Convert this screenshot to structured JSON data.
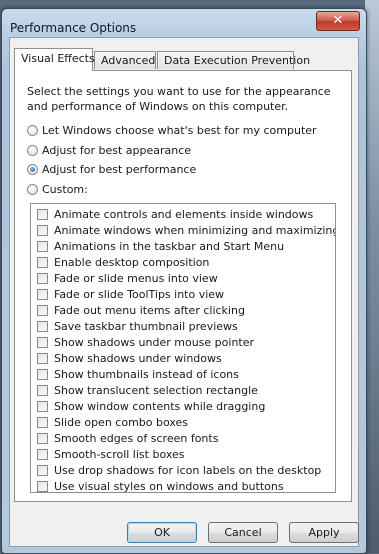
{
  "window": {
    "title": "Performance Options",
    "close_glyph": "✕"
  },
  "tabs": [
    {
      "label": "Visual Effects",
      "active": true
    },
    {
      "label": "Advanced",
      "active": false
    },
    {
      "label": "Data Execution Prevention",
      "active": false
    }
  ],
  "visual_effects": {
    "description": "Select the settings you want to use for the appearance and performance of Windows on this computer.",
    "options": [
      {
        "label": "Let Windows choose what's best for my computer",
        "checked": false
      },
      {
        "label": "Adjust for best appearance",
        "checked": false
      },
      {
        "label": "Adjust for best performance",
        "checked": true
      },
      {
        "label": "Custom:",
        "checked": false
      }
    ],
    "effects": [
      {
        "label": "Animate controls and elements inside windows",
        "checked": false
      },
      {
        "label": "Animate windows when minimizing and maximizing",
        "checked": false
      },
      {
        "label": "Animations in the taskbar and Start Menu",
        "checked": false
      },
      {
        "label": "Enable desktop composition",
        "checked": false
      },
      {
        "label": "Fade or slide menus into view",
        "checked": false
      },
      {
        "label": "Fade or slide ToolTips into view",
        "checked": false
      },
      {
        "label": "Fade out menu items after clicking",
        "checked": false
      },
      {
        "label": "Save taskbar thumbnail previews",
        "checked": false
      },
      {
        "label": "Show shadows under mouse pointer",
        "checked": false
      },
      {
        "label": "Show shadows under windows",
        "checked": false
      },
      {
        "label": "Show thumbnails instead of icons",
        "checked": false
      },
      {
        "label": "Show translucent selection rectangle",
        "checked": false
      },
      {
        "label": "Show window contents while dragging",
        "checked": false
      },
      {
        "label": "Slide open combo boxes",
        "checked": false
      },
      {
        "label": "Smooth edges of screen fonts",
        "checked": false
      },
      {
        "label": "Smooth-scroll list boxes",
        "checked": false
      },
      {
        "label": "Use drop shadows for icon labels on the desktop",
        "checked": false
      },
      {
        "label": "Use visual styles on windows and buttons",
        "checked": false
      }
    ]
  },
  "buttons": {
    "ok": "OK",
    "cancel": "Cancel",
    "apply": "Apply"
  },
  "colors": {
    "titlebar": "#b8cde3",
    "close": "#c0392b",
    "radio_selected": "#1a5ea8"
  }
}
